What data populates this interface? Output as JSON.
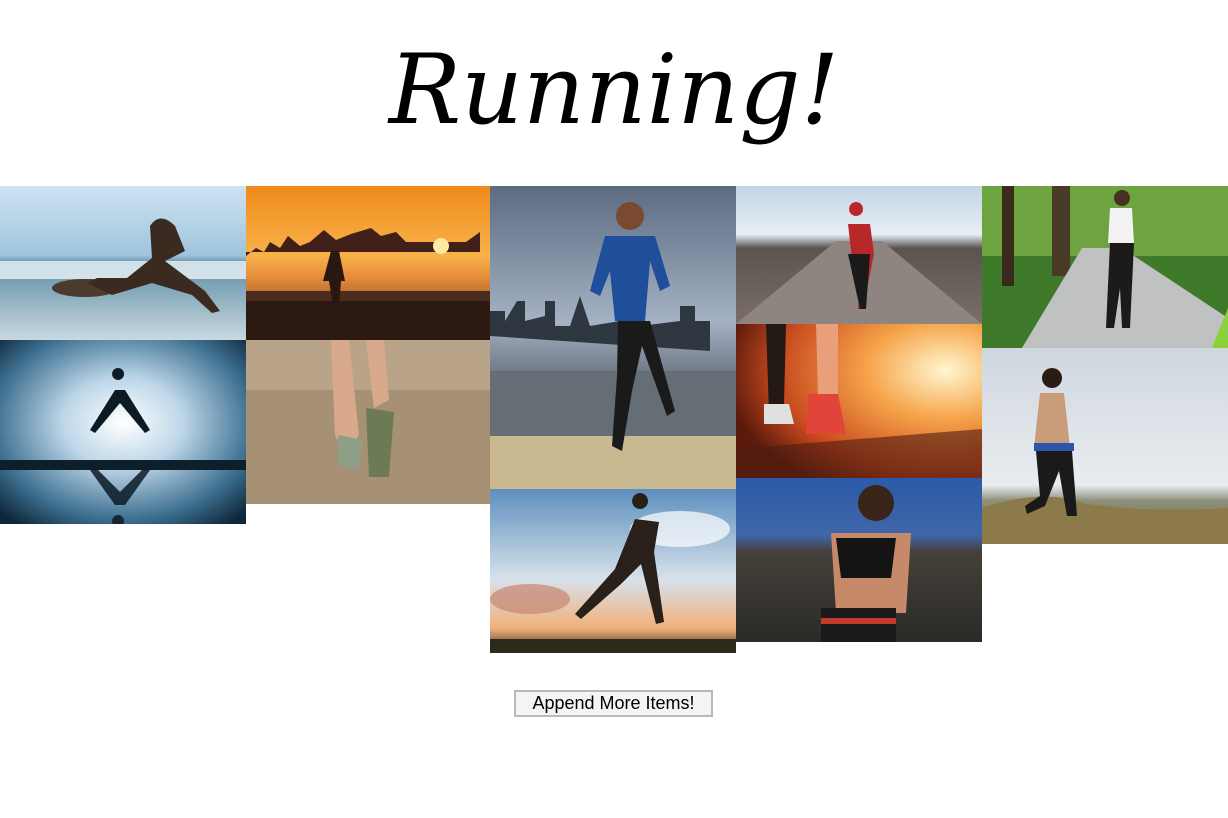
{
  "header": {
    "title": "Running!"
  },
  "gallery": {
    "photos": [
      {
        "subject": "runner leaping over rocks on a beach"
      },
      {
        "subject": "runner silhouette with reflection on water"
      },
      {
        "subject": "runner by city skyline at sunset"
      },
      {
        "subject": "close-up of running shoes on trail"
      },
      {
        "subject": "woman in blue jacket running by city waterfront"
      },
      {
        "subject": "runner silhouette against cloudy sky"
      },
      {
        "subject": "runner in red jacket on road"
      },
      {
        "subject": "running shoes on road at sunset"
      },
      {
        "subject": "woman running with earphones"
      },
      {
        "subject": "woman running on tree-lined path"
      },
      {
        "subject": "woman running on grassy hill"
      }
    ]
  },
  "actions": {
    "append_label": "Append More Items!"
  }
}
